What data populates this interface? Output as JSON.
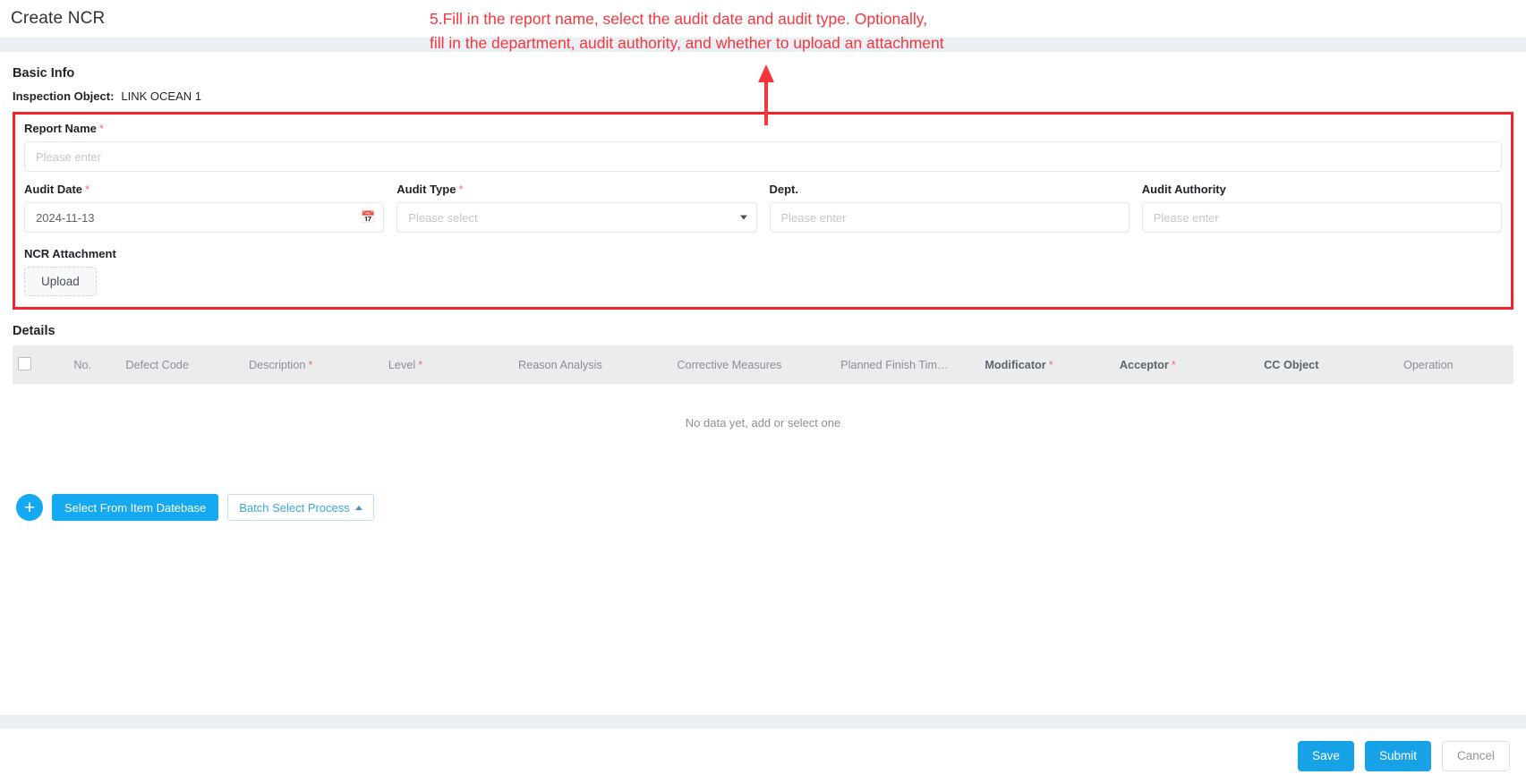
{
  "header": {
    "title": "Create NCR"
  },
  "annotation": {
    "text": "5.Fill in the report name, select the audit date and audit type. Optionally,\nfill in the department, audit authority, and whether to upload an attachment",
    "color": "#f5363c",
    "arrow_icon": "up-arrow-icon"
  },
  "basic_info": {
    "section_title": "Basic Info",
    "inspection_object_label": "Inspection Object:",
    "inspection_object_value": "LINK OCEAN 1",
    "fields": {
      "report_name": {
        "label": "Report Name",
        "required": "*",
        "value": "",
        "placeholder": "Please enter"
      },
      "audit_date": {
        "label": "Audit Date",
        "required": "*",
        "value": "2024-11-13",
        "icon": "calendar-icon"
      },
      "audit_type": {
        "label": "Audit Type",
        "required": "*",
        "value": "Please select",
        "placeholder": "Please select",
        "icon": "chevron-down-icon"
      },
      "dept": {
        "label": "Dept.",
        "required": "",
        "value": "",
        "placeholder": "Please enter"
      },
      "audit_authority": {
        "label": "Audit Authority",
        "required": "",
        "value": "",
        "placeholder": "Please enter"
      },
      "ncr_attachment": {
        "label": "NCR Attachment",
        "upload_label": "Upload"
      }
    },
    "highlight_color": "#f5222d"
  },
  "details": {
    "section_title": "Details",
    "columns": [
      {
        "label": "",
        "name": "select-all-checkbox",
        "strong": false
      },
      {
        "label": "No.",
        "name": "no",
        "strong": false
      },
      {
        "label": "Defect Code",
        "name": "defect-code",
        "strong": false
      },
      {
        "label": "Description",
        "required": "*",
        "name": "description",
        "strong": false
      },
      {
        "label": "Level",
        "required": "*",
        "name": "level",
        "strong": false
      },
      {
        "label": "Reason Analysis",
        "name": "reason-analysis",
        "strong": false
      },
      {
        "label": "Corrective Measures",
        "name": "corrective-measures",
        "strong": false
      },
      {
        "label": "Planned Finish Tim…",
        "name": "planned-finish-time",
        "strong": false
      },
      {
        "label": "Modificator",
        "required": "*",
        "name": "modificator",
        "strong": true
      },
      {
        "label": "Acceptor",
        "required": "*",
        "name": "acceptor",
        "strong": true
      },
      {
        "label": "CC Object",
        "name": "cc-object",
        "strong": true
      },
      {
        "label": "Operation",
        "name": "operation",
        "strong": false
      }
    ],
    "rows": [],
    "empty_text": "No data yet, add or select one",
    "actions": {
      "add_label": "+",
      "select_from_item_database": "Select From Item Datebase",
      "batch_select_process": "Batch Select Process"
    }
  },
  "footer": {
    "save_label": "Save",
    "submit_label": "Submit",
    "cancel_label": "Cancel"
  },
  "colors": {
    "primary": "#17a2e8",
    "accent_light": "#14a9f0",
    "required": "#f56c6c",
    "annotation": "#f5363c"
  }
}
